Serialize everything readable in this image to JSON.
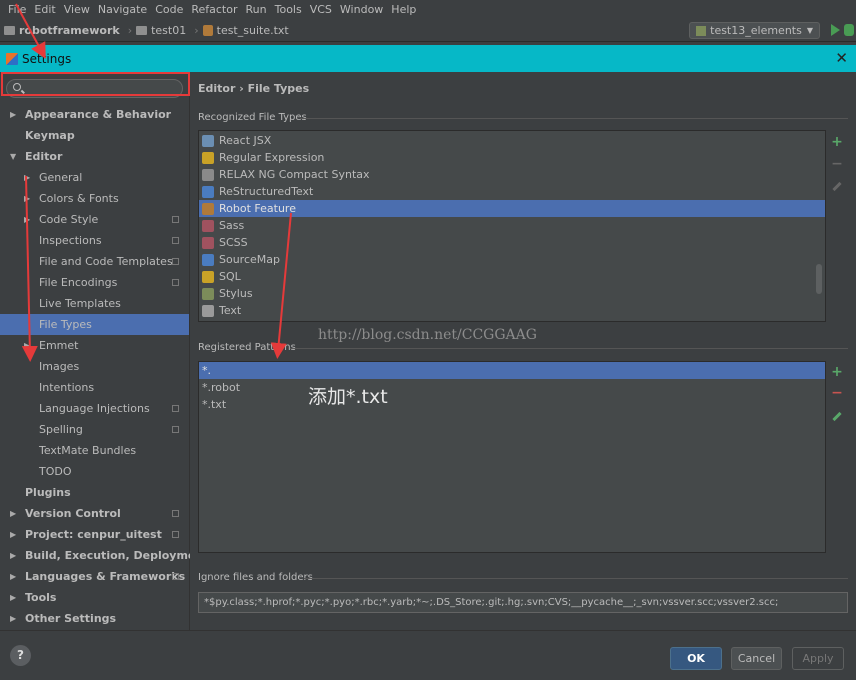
{
  "menubar": {
    "items": [
      "File",
      "Edit",
      "View",
      "Navigate",
      "Code",
      "Refactor",
      "Run",
      "Tools",
      "VCS",
      "Window",
      "Help"
    ]
  },
  "navbar": {
    "project": "robotframework",
    "folder": "test01",
    "file": "test_suite.txt",
    "run_config": "test13_elements"
  },
  "dialog": {
    "title": "Settings",
    "breadcrumb": "Editor › File Types"
  },
  "tree": {
    "items": [
      {
        "label": "Appearance & Behavior",
        "level": 0,
        "bold": true,
        "arrow": "▶"
      },
      {
        "label": "Keymap",
        "level": 0,
        "bold": true,
        "arrow": ""
      },
      {
        "label": "Editor",
        "level": 0,
        "bold": true,
        "arrow": "▼"
      },
      {
        "label": "General",
        "level": 1,
        "bold": false,
        "arrow": "▶"
      },
      {
        "label": "Colors & Fonts",
        "level": 1,
        "bold": false,
        "arrow": "▶"
      },
      {
        "label": "Code Style",
        "level": 1,
        "bold": false,
        "arrow": "▶",
        "copy": true
      },
      {
        "label": "Inspections",
        "level": 1,
        "bold": false,
        "arrow": "",
        "copy": true
      },
      {
        "label": "File and Code Templates",
        "level": 1,
        "bold": false,
        "arrow": "",
        "copy": true
      },
      {
        "label": "File Encodings",
        "level": 1,
        "bold": false,
        "arrow": "",
        "copy": true
      },
      {
        "label": "Live Templates",
        "level": 1,
        "bold": false,
        "arrow": ""
      },
      {
        "label": "File Types",
        "level": 1,
        "bold": false,
        "arrow": "",
        "selected": true
      },
      {
        "label": "Emmet",
        "level": 1,
        "bold": false,
        "arrow": "▶"
      },
      {
        "label": "Images",
        "level": 1,
        "bold": false,
        "arrow": ""
      },
      {
        "label": "Intentions",
        "level": 1,
        "bold": false,
        "arrow": ""
      },
      {
        "label": "Language Injections",
        "level": 1,
        "bold": false,
        "arrow": "",
        "copy": true
      },
      {
        "label": "Spelling",
        "level": 1,
        "bold": false,
        "arrow": "",
        "copy": true
      },
      {
        "label": "TextMate Bundles",
        "level": 1,
        "bold": false,
        "arrow": ""
      },
      {
        "label": "TODO",
        "level": 1,
        "bold": false,
        "arrow": ""
      },
      {
        "label": "Plugins",
        "level": 0,
        "bold": true,
        "arrow": ""
      },
      {
        "label": "Version Control",
        "level": 0,
        "bold": true,
        "arrow": "▶",
        "copy": true
      },
      {
        "label": "Project: cenpur_uitest",
        "level": 0,
        "bold": true,
        "arrow": "▶",
        "copy": true
      },
      {
        "label": "Build, Execution, Deployment",
        "level": 0,
        "bold": true,
        "arrow": "▶"
      },
      {
        "label": "Languages & Frameworks",
        "level": 0,
        "bold": true,
        "arrow": "▶",
        "copy": true
      },
      {
        "label": "Tools",
        "level": 0,
        "bold": true,
        "arrow": "▶"
      },
      {
        "label": "Other Settings",
        "level": 0,
        "bold": true,
        "arrow": "▶"
      }
    ]
  },
  "recognized": {
    "title": "Recognized File Types",
    "items": [
      {
        "label": "React JSX",
        "color": "#6b8fb3"
      },
      {
        "label": "Regular Expression",
        "color": "#c9a227"
      },
      {
        "label": "RELAX NG Compact Syntax",
        "color": "#8a8a8a"
      },
      {
        "label": "ReStructuredText",
        "color": "#4a7cc0"
      },
      {
        "label": "Robot Feature",
        "color": "#b07a3a",
        "selected": true
      },
      {
        "label": "Sass",
        "color": "#a0525f"
      },
      {
        "label": "SCSS",
        "color": "#a0525f"
      },
      {
        "label": "SourceMap",
        "color": "#4a7cc0"
      },
      {
        "label": "SQL",
        "color": "#c9a227"
      },
      {
        "label": "Stylus",
        "color": "#7c8c5a"
      },
      {
        "label": "Text",
        "color": "#9a9a9a"
      }
    ]
  },
  "patterns": {
    "title": "Registered Patterns",
    "items": [
      {
        "label": "*.",
        "selected": true
      },
      {
        "label": "*.robot"
      },
      {
        "label": "*.txt"
      }
    ]
  },
  "ignore": {
    "title": "Ignore files and folders",
    "value": "*$py.class;*.hprof;*.pyc;*.pyo;*.rbc;*.yarb;*~;.DS_Store;.git;.hg;.svn;CVS;__pycache__;_svn;vssver.scc;vssver2.scc;"
  },
  "watermark": "http://blog.csdn.net/CCGGAAG",
  "annotation": "添加*.txt",
  "buttons": {
    "help": "?",
    "ok": "OK",
    "cancel": "Cancel",
    "apply": "Apply"
  },
  "colors": {
    "title_bar": "#06b8c7",
    "selection": "#4b6eaf",
    "highlight_box": "#e53a3a"
  }
}
